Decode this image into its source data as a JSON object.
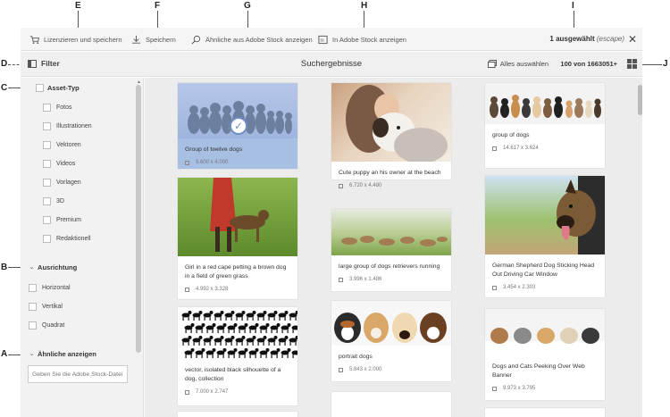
{
  "callouts": {
    "a": "A",
    "b": "B",
    "c": "C",
    "d": "D",
    "e": "E",
    "f": "F",
    "g": "G",
    "h": "H",
    "i": "I",
    "j": "J"
  },
  "actions": {
    "license_save": "Lizenzieren und speichern",
    "save": "Speichern",
    "find_similar": "Ähnliche aus Adobe Stock anzeigen",
    "view_stock": "In Adobe Stock anzeigen",
    "selected_count": "1 ausgewählt",
    "escape_hint": "(escape)",
    "close": "✕"
  },
  "header": {
    "filter_label": "Filter",
    "title": "Suchergebnisse",
    "select_all": "Alles auswählen",
    "result_count": "100 von 1663051+"
  },
  "sidebar": {
    "asset_type": {
      "label": "Asset-Typ",
      "options": [
        "Fotos",
        "Illustrationen",
        "Vektoren",
        "Videos",
        "Vorlagen",
        "3D",
        "Premium",
        "Redaktionell"
      ]
    },
    "orientation": {
      "label": "Ausrichtung",
      "options": [
        "Horizontal",
        "Vertikal",
        "Quadrat"
      ]
    },
    "similar": {
      "label": "Ähnliche anzeigen",
      "placeholder": "Geben Sie die Adobe Stock-Datei"
    }
  },
  "results": [
    {
      "caption": "Group of twelve dogs",
      "dims": "9.600 x 4.000",
      "selected": true
    },
    {
      "caption": "Cute puppy an his owner at the beach",
      "dims": "6.720 x 4.480"
    },
    {
      "caption": "group of dogs",
      "dims": "14.617 x 3.624"
    },
    {
      "caption": "Girl in a red cape petting a brown dog in a field of green grass",
      "dims": "4.992 x 3.328"
    },
    {
      "caption": "large group of dogs retrievers running",
      "dims": "3.996 x 1.486"
    },
    {
      "caption": "German Shepherd Dog Sticking Head Out Driving Car Window",
      "dims": "3.454 x 2.303"
    },
    {
      "caption": "vector, isolated black silhouette of a dog, collection",
      "dims": "7.000 x 2.747"
    },
    {
      "caption": "portrait dogs",
      "dims": "5.843 x 2.000"
    },
    {
      "caption": "Dogs and Cats Peeking Over Web Banner",
      "dims": "9.973 x 3.795"
    }
  ],
  "colors": {
    "selected_card": "#a8bfe4",
    "accent": "#6f8fc5"
  }
}
